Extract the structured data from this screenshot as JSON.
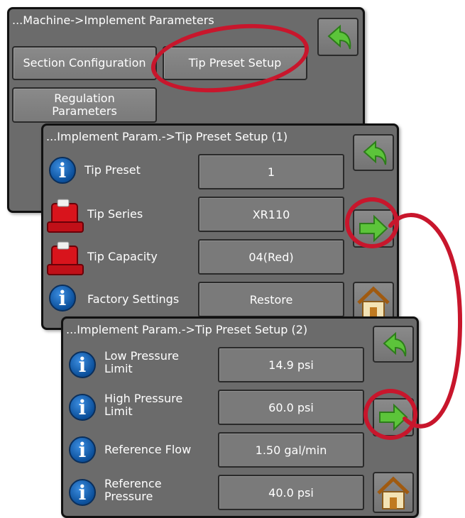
{
  "screen1": {
    "breadcrumb": "...Machine->Implement Parameters",
    "section_config": "Section Configuration",
    "tip_preset_setup": "Tip Preset Setup",
    "regulation_line1": "Regulation",
    "regulation_line2": "Parameters"
  },
  "screen2": {
    "breadcrumb": "...Implement Param.->Tip Preset Setup (1)",
    "rows": [
      {
        "label": "Tip Preset",
        "value": "1",
        "icon": "info-icon"
      },
      {
        "label": "Tip Series",
        "value": "XR110",
        "icon": "red-nozzle-icon"
      },
      {
        "label": "Tip Capacity",
        "value": "04(Red)",
        "icon": "red-nozzle-icon"
      },
      {
        "label": "Factory Settings",
        "value": "Restore",
        "icon": "info-icon"
      }
    ]
  },
  "screen3": {
    "breadcrumb": "...Implement Param.->Tip Preset Setup (2)",
    "rows": [
      {
        "label1": "Low Pressure",
        "label2": "Limit",
        "value": "14.9 psi"
      },
      {
        "label1": "High Pressure",
        "label2": "Limit",
        "value": "60.0 psi"
      },
      {
        "label1": "Reference Flow",
        "label2": "",
        "value": "1.50 gal/min"
      },
      {
        "label1": "Reference",
        "label2": "Pressure",
        "value": "40.0 psi"
      }
    ]
  },
  "icons": {
    "info_glyph": "i",
    "back": "back-arrow-icon",
    "next": "next-arrow-icon",
    "home": "home-icon"
  },
  "colors": {
    "panel": "#6b6b6b",
    "highlight_ring": "#c8162c",
    "arrow_green": "#5cc43a",
    "nozzle_red": "#d8141c",
    "info_blue": "#1a6cc2"
  }
}
